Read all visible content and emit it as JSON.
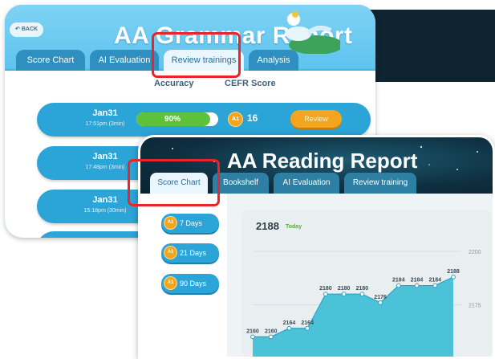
{
  "grammar_report": {
    "back_label": "BACK",
    "title": "AA Grammar Report",
    "tabs": [
      {
        "label": "Score Chart",
        "active": false
      },
      {
        "label": "AI Evaluation",
        "active": false
      },
      {
        "label": "Review trainings",
        "active": true
      },
      {
        "label": "Analysis",
        "active": false
      }
    ],
    "columns": {
      "accuracy": "Accuracy",
      "cefr": "CEFR Score"
    },
    "sessions": [
      {
        "date": "Jan31",
        "time": "17:51pm (3min)",
        "accuracy": "90%",
        "accuracy_value": 0.9,
        "level": "A1",
        "score": "16",
        "review_label": "Review"
      },
      {
        "date": "Jan31",
        "time": "17:48pm (3min)"
      },
      {
        "date": "Jan31",
        "time": "15:18pm (30min)"
      }
    ]
  },
  "reading_report": {
    "title": "AA Reading Report",
    "tabs": [
      {
        "label": "Score Chart",
        "active": true
      },
      {
        "label": "Bookshelf",
        "active": false
      },
      {
        "label": "AI Evaluation",
        "active": false
      },
      {
        "label": "Review training",
        "active": false
      }
    ],
    "ranges": [
      {
        "level": "A1",
        "label": "7 Days"
      },
      {
        "level": "A1",
        "label": "21 Days"
      },
      {
        "level": "A1",
        "label": "90 Days"
      }
    ],
    "current_score": "2188",
    "current_label": "Today"
  },
  "colors": {
    "accent": "#2ba4d8",
    "orange": "#f3a51d",
    "green": "#5cc23a",
    "highlight": "#e8252b",
    "area": "#4cc2d8"
  },
  "chart_data": {
    "type": "area",
    "x": [
      1,
      2,
      3,
      4,
      5,
      6,
      7,
      8,
      9,
      10,
      11,
      12
    ],
    "values": [
      2160,
      2160,
      2164,
      2164,
      2180,
      2180,
      2180,
      2176,
      2184,
      2184,
      2184,
      2188
    ],
    "point_labels": [
      "2160",
      "2160",
      "2164",
      "2164",
      "2180",
      "2180",
      "2180",
      "2176",
      "2184",
      "2184",
      "2184",
      "2188"
    ],
    "yticks": [
      "2150",
      "2175",
      "2200"
    ],
    "ylim": [
      2150,
      2200
    ],
    "grid": true,
    "title": "",
    "xlabel": "",
    "ylabel": ""
  }
}
